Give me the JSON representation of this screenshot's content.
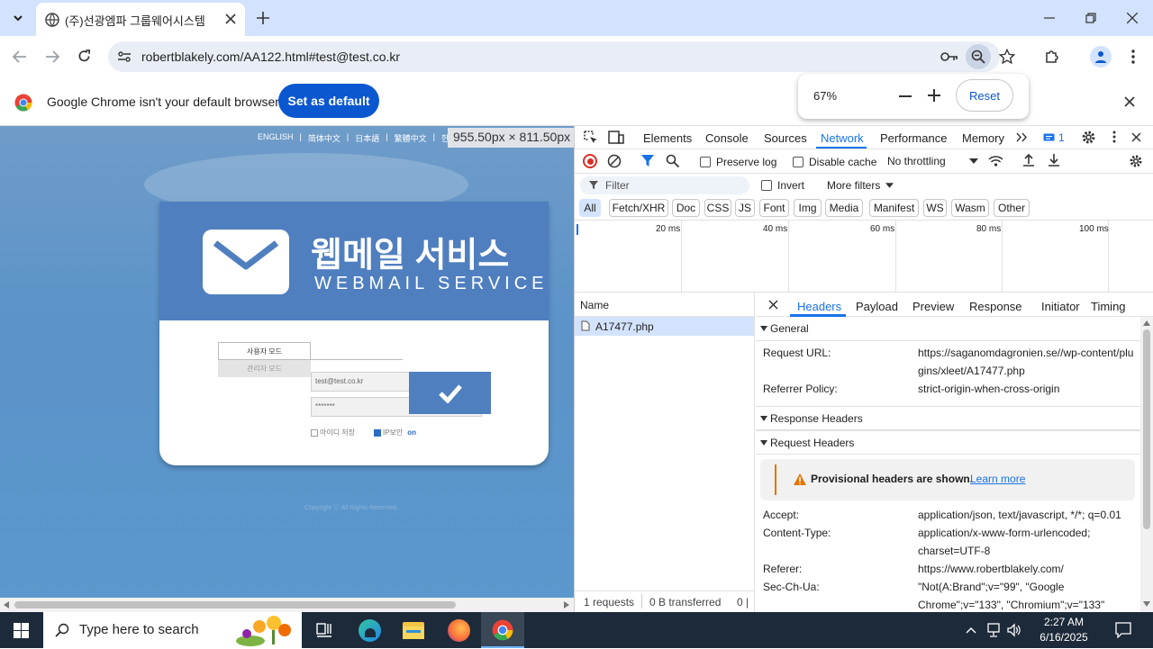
{
  "browser": {
    "tab_title": "(주)선광엠파 그룹웨어시스템",
    "url": "robertblakely.com/AA122.html#test@test.co.kr",
    "zoom_popup": {
      "value": "67%",
      "reset_label": "Reset"
    },
    "infobar": {
      "message": "Google Chrome isn't your default browser",
      "button": "Set as default"
    }
  },
  "page": {
    "languages": [
      "ENGLISH",
      "简体中文",
      "日本語",
      "繁體中文",
      "한국어"
    ],
    "size_overlay": "955.50px × 811.50px",
    "banner_title_ko": "웹메일 서비스",
    "banner_title_en": "WEBMAIL SERVICE",
    "mode_user": "사용자 모드",
    "mode_admin": "관리자 모드",
    "email_value": "test@test.co.kr",
    "password_value": "*******",
    "save_id_label": "아이디 저장",
    "ip_security_label": "IP보안",
    "ip_security_state": "on",
    "copyright": "Copyright ⓒ All Rights Reserved."
  },
  "devtools": {
    "tabs": [
      "Elements",
      "Console",
      "Sources",
      "Network",
      "Performance",
      "Memory"
    ],
    "active_tab": "Network",
    "issues_count": "1",
    "toolbar": {
      "preserve_log": "Preserve log",
      "disable_cache": "Disable cache",
      "throttling": "No throttling"
    },
    "filter_placeholder": "Filter",
    "invert_label": "Invert",
    "more_filters": "More filters",
    "type_filters": [
      "All",
      "Fetch/XHR",
      "Doc",
      "CSS",
      "JS",
      "Font",
      "Img",
      "Media",
      "Manifest",
      "WS",
      "Wasm",
      "Other"
    ],
    "timeline_ticks": [
      "20 ms",
      "40 ms",
      "60 ms",
      "80 ms",
      "100 ms"
    ],
    "list_header": "Name",
    "request_name": "A17477.php",
    "status": {
      "requests": "1 requests",
      "transferred": "0 B transferred",
      "extra": "0 |"
    },
    "detail_tabs": [
      "Headers",
      "Payload",
      "Preview",
      "Response",
      "Initiator",
      "Timing"
    ],
    "general": {
      "title": "General",
      "request_url_key": "Request URL:",
      "request_url_value": "https://saganomdagronien.se//wp-content/plugins/xleet/A17477.php",
      "referrer_policy_key": "Referrer Policy:",
      "referrer_policy_value": "strict-origin-when-cross-origin"
    },
    "response_headers_title": "Response Headers",
    "request_headers": {
      "title": "Request Headers",
      "warning": "Provisional headers are shown.",
      "learn_more": "Learn more",
      "accept_key": "Accept:",
      "accept_value": "application/json, text/javascript, */*; q=0.01",
      "content_type_key": "Content-Type:",
      "content_type_value": "application/x-www-form-urlencoded; charset=UTF-8",
      "referer_key": "Referer:",
      "referer_value": "https://www.robertblakely.com/",
      "sec_ch_ua_key": "Sec-Ch-Ua:",
      "sec_ch_ua_value": "\"Not(A:Brand\";v=\"99\", \"Google Chrome\";v=\"133\", \"Chromium\";v=\"133\""
    }
  },
  "taskbar": {
    "search_placeholder": "Type here to search",
    "time": "2:27 AM",
    "date": "6/16/2025"
  },
  "colors": {
    "chrome_blue": "#0b57d0",
    "tab_strip": "#d3e3fd",
    "devtools_active": "#1a73e8",
    "banner_blue": "#4f7fbf",
    "taskbar": "#1d2a3a"
  }
}
